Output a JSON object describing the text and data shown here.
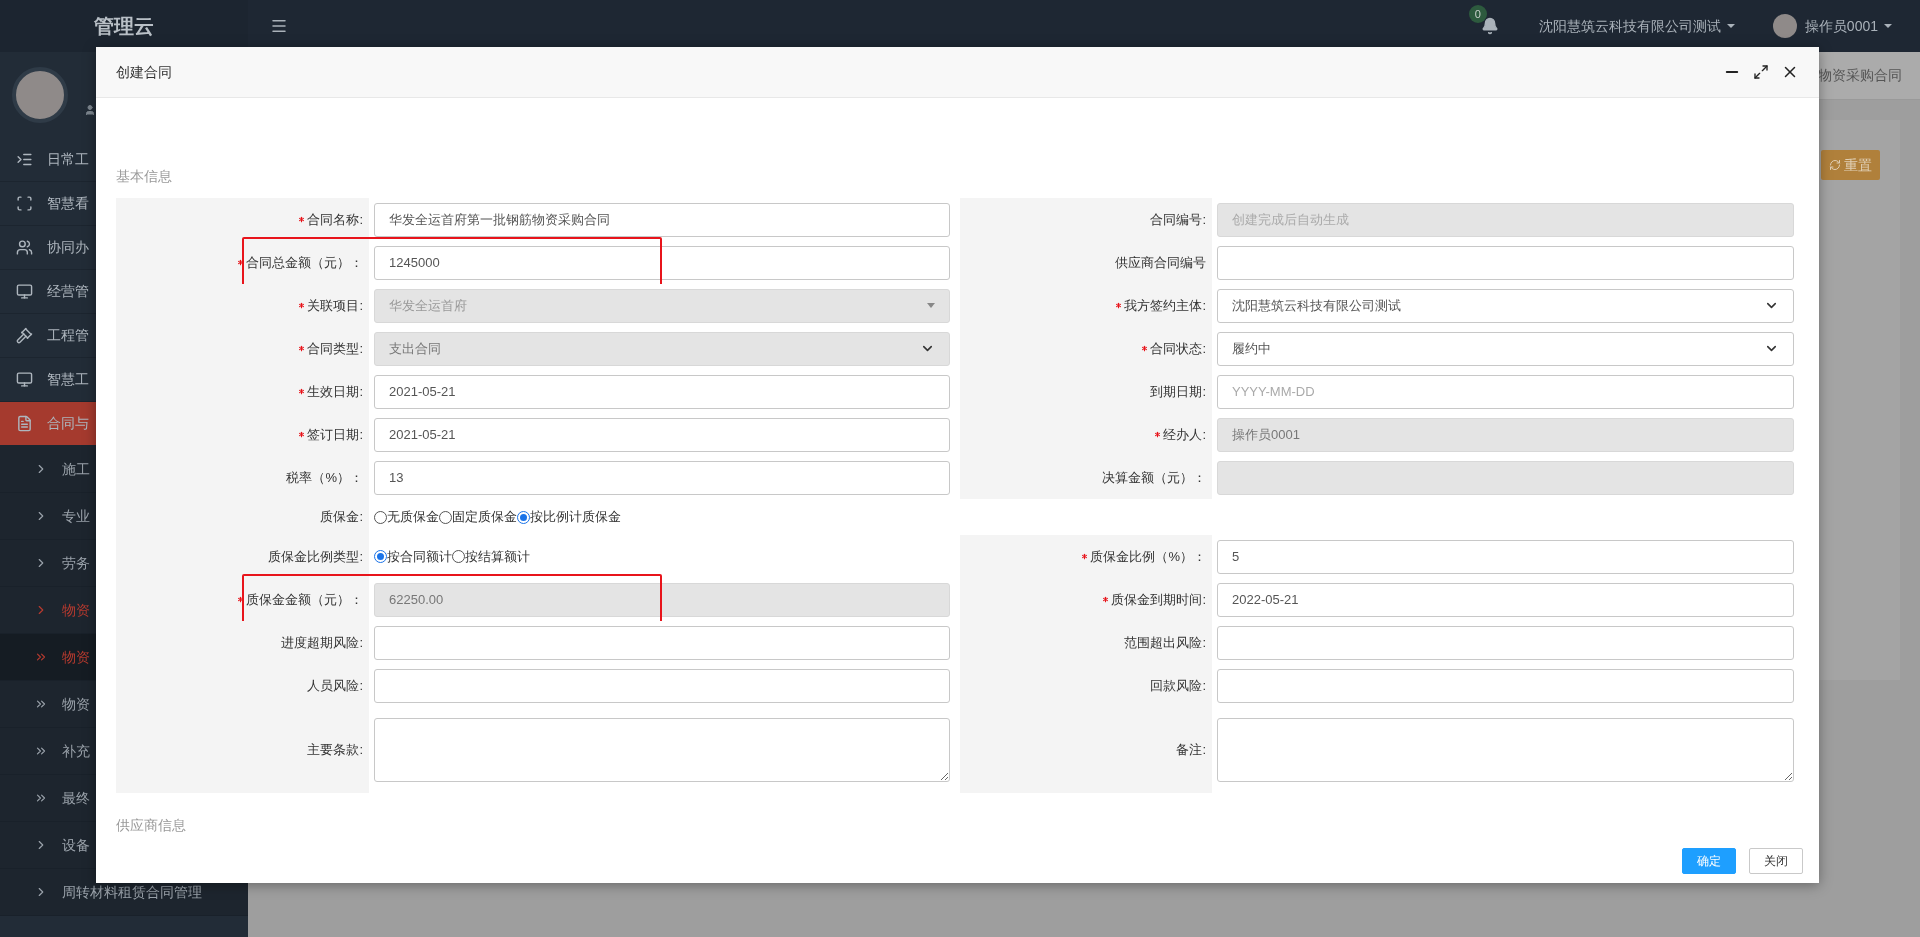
{
  "sidebar": {
    "logo": "管理云",
    "items": [
      {
        "label": "日常工",
        "selected": false
      },
      {
        "label": "智慧看",
        "selected": false
      },
      {
        "label": "协同办",
        "selected": false
      },
      {
        "label": "经营管",
        "selected": false
      },
      {
        "label": "工程管",
        "selected": false
      },
      {
        "label": "智慧工",
        "selected": false
      },
      {
        "label": "合同与",
        "selected": true,
        "children": [
          {
            "label": "施工",
            "expanded": false
          },
          {
            "label": "专业",
            "expanded": false
          },
          {
            "label": "劳务",
            "expanded": false
          },
          {
            "label": "物资",
            "expanded": true,
            "children": [
              {
                "label": "物资",
                "selected": true
              },
              {
                "label": "物资",
                "selected": false
              },
              {
                "label": "补充",
                "selected": false
              },
              {
                "label": "最终",
                "selected": false
              }
            ]
          },
          {
            "label": "设备",
            "expanded": false
          },
          {
            "label": "周转材料租赁合同管理",
            "expanded": false
          }
        ]
      }
    ]
  },
  "top_bar": {
    "notifications": "0",
    "company": "沈阳慧筑云科技有限公司测试",
    "user": "操作员0001"
  },
  "background": {
    "tab": "物资采购合同",
    "reset_button": "重置"
  },
  "modal": {
    "title": "创建合同",
    "section": "基本信息",
    "rows": [
      {
        "left": {
          "label": "合同名称:",
          "required": true,
          "kind": "text",
          "disabled": false,
          "highlighted": false,
          "value": "华发全运首府第一批钢筋物资采购合同"
        },
        "right": {
          "label": "合同编号:",
          "required": false,
          "kind": "text",
          "disabled": true,
          "highlighted": false,
          "placeholder": "创建完成后自动生成"
        }
      },
      {
        "left": {
          "label": "合同总金额（元）：",
          "required": true,
          "kind": "text",
          "disabled": false,
          "highlighted": true,
          "value": "1245000"
        },
        "right": {
          "label": "供应商合同编号",
          "required": false,
          "kind": "text",
          "disabled": false,
          "highlighted": false
        }
      },
      {
        "left": {
          "label": "关联项目:",
          "required": true,
          "kind": "combo",
          "disabled": true,
          "highlighted": false,
          "value": "华发全运首府"
        },
        "right": {
          "label": "我方签约主体:",
          "required": true,
          "kind": "select",
          "disabled": false,
          "highlighted": false,
          "value": "沈阳慧筑云科技有限公司测试"
        }
      },
      {
        "left": {
          "label": "合同类型:",
          "required": true,
          "kind": "select",
          "disabled": true,
          "highlighted": false,
          "value": "支出合同"
        },
        "right": {
          "label": "合同状态:",
          "required": true,
          "kind": "select",
          "disabled": false,
          "highlighted": false,
          "value": "履约中"
        }
      },
      {
        "left": {
          "label": "生效日期:",
          "required": true,
          "kind": "text",
          "disabled": false,
          "highlighted": false,
          "value": "2021-05-21"
        },
        "right": {
          "label": "到期日期:",
          "required": false,
          "kind": "text",
          "disabled": false,
          "highlighted": false,
          "placeholder": "YYYY-MM-DD"
        }
      },
      {
        "left": {
          "label": "签订日期:",
          "required": true,
          "kind": "text",
          "disabled": false,
          "highlighted": false,
          "value": "2021-05-21"
        },
        "right": {
          "label": "经办人:",
          "required": true,
          "kind": "text",
          "disabled": true,
          "highlighted": false,
          "value": "操作员0001"
        }
      },
      {
        "left": {
          "label": "税率（%）：",
          "required": false,
          "kind": "text",
          "disabled": false,
          "highlighted": false,
          "value": "13"
        },
        "right": {
          "label": "决算金额（元）：",
          "required": false,
          "kind": "text",
          "disabled": true,
          "highlighted": false
        }
      },
      {
        "left": {
          "label": "质保金:",
          "required": false,
          "kind": "radio",
          "highlighted": false,
          "options": [
            {
              "label": "无质保金",
              "selected": false
            },
            {
              "label": "固定质保金",
              "selected": false
            },
            {
              "label": "按比例计质保金",
              "selected": true
            }
          ]
        }
      },
      {
        "left": {
          "label": "质保金比例类型:",
          "required": false,
          "kind": "radio",
          "highlighted": false,
          "options": [
            {
              "label": "按合同额计",
              "selected": true
            },
            {
              "label": "按结算额计",
              "selected": false
            }
          ]
        },
        "right": {
          "label": "质保金比例（%）：",
          "required": true,
          "kind": "text",
          "disabled": false,
          "highlighted": false,
          "value": "5"
        }
      },
      {
        "left": {
          "label": "质保金金额（元）：",
          "required": true,
          "kind": "text",
          "disabled": true,
          "highlighted": true,
          "value": "62250.00"
        },
        "right": {
          "label": "质保金到期时间:",
          "required": true,
          "kind": "text",
          "disabled": false,
          "highlighted": false,
          "value": "2022-05-21"
        }
      },
      {
        "left": {
          "label": "进度超期风险:",
          "required": false,
          "kind": "text",
          "disabled": false,
          "highlighted": false
        },
        "right": {
          "label": "范围超出风险:",
          "required": false,
          "kind": "text",
          "disabled": false,
          "highlighted": false
        }
      },
      {
        "left": {
          "label": "人员风险:",
          "required": false,
          "kind": "text",
          "disabled": false,
          "highlighted": false
        },
        "right": {
          "label": "回款风险:",
          "required": false,
          "kind": "text",
          "disabled": false,
          "highlighted": false
        }
      },
      {
        "left": {
          "label": "主要条款:",
          "required": false,
          "kind": "textarea",
          "disabled": false,
          "highlighted": false
        },
        "right": {
          "label": "备注:",
          "required": false,
          "kind": "textarea",
          "disabled": false,
          "highlighted": false
        }
      }
    ],
    "next_section": "供应商信息",
    "buttons": [
      {
        "label": "确定",
        "kind": "primary"
      },
      {
        "label": "关闭",
        "kind": "default"
      }
    ]
  }
}
